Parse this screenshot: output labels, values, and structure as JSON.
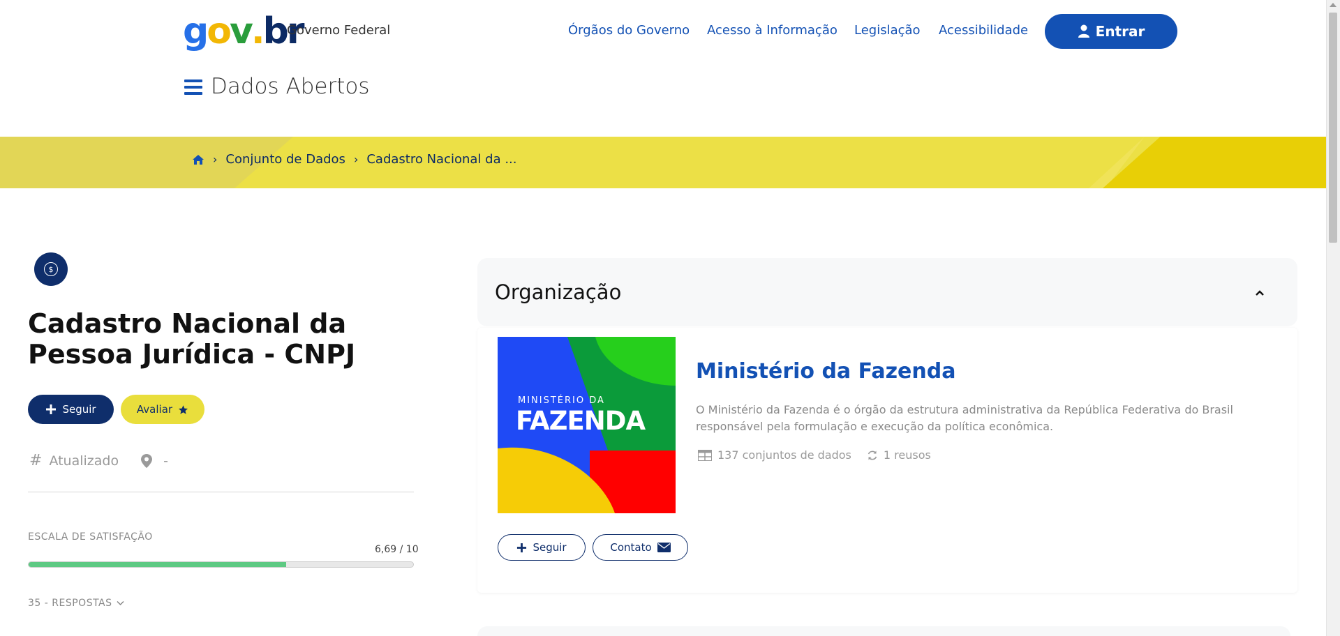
{
  "header": {
    "logo": {
      "g": "g",
      "o": "o",
      "v": "v",
      "dot": ".",
      "b": "b",
      "r": "r"
    },
    "gov_label": "Governo Federal",
    "nav": [
      "Órgãos do Governo",
      "Acesso à Informação",
      "Legislação",
      "Acessibilidade"
    ],
    "login_label": "Entrar",
    "site_title": "Dados Abertos"
  },
  "breadcrumb": {
    "items": [
      "Conjunto de Dados",
      "Cadastro Nacional da ..."
    ]
  },
  "dataset": {
    "icon_symbol": "$",
    "title": "Cadastro Nacional da Pessoa Jurídica - CNPJ",
    "follow_label": "Seguir",
    "rate_label": "Avaliar",
    "updated_label": "Atualizado",
    "location_value": "-",
    "satisfaction_label": "ESCALA DE SATISFAÇÃO",
    "satisfaction_value": "6,69 / 10",
    "satisfaction_fraction": 0.669,
    "responses_label": "35 - RESPOSTAS"
  },
  "organization": {
    "section_title": "Organização",
    "logo_line1": "MINISTÉRIO DA",
    "logo_line2": "FAZENDA",
    "name": "Ministério da Fazenda",
    "description": "O Ministério da Fazenda é o órgão da estrutura administrativa da República Federativa do Brasil responsável pela formulação e execução da política econômica.",
    "datasets_count": "137 conjuntos de dados",
    "reuses_count": "1 reusos",
    "follow_label": "Seguir",
    "contact_label": "Contato"
  },
  "colors": {
    "primary_blue": "#1351b4",
    "dark_navy": "#0f2e6b",
    "gov_yellow": "#ece046",
    "satisfaction_green": "#5ec983"
  }
}
